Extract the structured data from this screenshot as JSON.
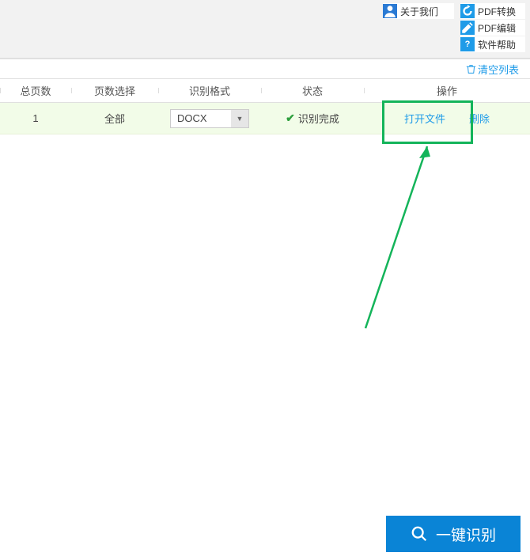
{
  "top": {
    "about": "关于我们",
    "pdf_convert": "PDF转换",
    "pdf_edit": "PDF编辑",
    "help": "软件帮助"
  },
  "clear_list": "清空列表",
  "headers": {
    "total_pages": "总页数",
    "page_select": "页数选择",
    "format": "识别格式",
    "status": "状态",
    "operation": "操作"
  },
  "row": {
    "total_pages": "1",
    "page_select": "全部",
    "format": "DOCX",
    "status": "识别完成",
    "open_file": "打开文件",
    "delete": "删除"
  },
  "recognize_btn": "一键识别"
}
